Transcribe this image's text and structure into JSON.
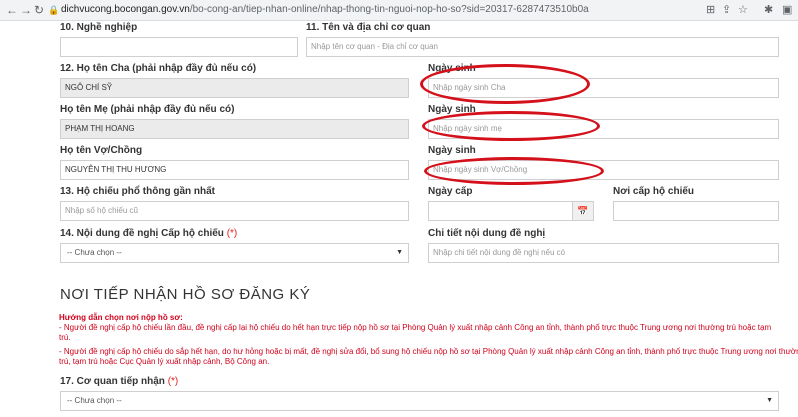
{
  "browser": {
    "url_host": "dichvucong.bocongan.gov.vn",
    "url_path": "/bo-cong-an/tiep-nhan-online/nhap-thong-tin-nguoi-nop-ho-so?sid=20317-6287473510b0a",
    "back_icon": "←",
    "forward_icon": "→",
    "reload_icon": "↻",
    "lock_icon": "🔒"
  },
  "fields": {
    "occupation": {
      "label": "10. Nghề nghiệp",
      "value": ""
    },
    "workplace": {
      "label": "11. Tên và địa chỉ cơ quan",
      "placeholder": "Nhập tên cơ quan - Địa chỉ cơ quan"
    },
    "father_name": {
      "label": "12. Họ tên Cha (phải nhập đầy đủ nếu có)",
      "value": "NGÔ CHÍ SỸ"
    },
    "father_dob": {
      "label": "Ngày sinh",
      "placeholder": "Nhập ngày sinh Cha"
    },
    "mother_name": {
      "label": "Họ tên Mẹ (phải nhập đầy đủ nếu có)",
      "value": "PHẠM THỊ HOANG"
    },
    "mother_dob": {
      "label": "Ngày sinh",
      "placeholder": "Nhập ngày sinh mẹ"
    },
    "spouse_name": {
      "label": "Họ tên Vợ/Chồng",
      "value": "NGUYỄN THỊ THU HƯƠNG"
    },
    "spouse_dob": {
      "label": "Ngày sinh",
      "placeholder": "Nhập ngày sinh Vợ/Chồng"
    },
    "passport_no": {
      "label": "13. Hộ chiếu phổ thông gần nhất",
      "placeholder": "Nhập số hộ chiếu cũ"
    },
    "issue_date": {
      "label": "Ngày cấp",
      "value": ""
    },
    "issue_place": {
      "label": "Nơi cấp hộ chiếu",
      "value": ""
    },
    "request": {
      "label": "14. Nội dung đề nghị Cấp hộ chiếu",
      "required": "(*)",
      "selected": "-- Chưa chọn --"
    },
    "request_detail": {
      "label": "Chi tiết nội dung đề nghị",
      "placeholder": "Nhập chi tiết nội dung đề nghị nếu có"
    },
    "receiving_agency": {
      "label": "17. Cơ quan tiếp nhận",
      "required": "(*)",
      "selected": "-- Chưa chọn --"
    }
  },
  "section": {
    "title": "NƠI TIẾP NHẬN HỒ SƠ ĐĂNG KÝ",
    "guide_heading": "Hướng dẫn chọn nơi nộp hồ sơ:",
    "guide_line1": "- Người đề nghị cấp hộ chiếu lần đầu, đề nghị cấp lại hộ chiếu do hết hạn trực tiếp nộp hồ sơ tại Phòng Quản lý xuất nhập cảnh Công an tỉnh, thành phố trực thuộc Trung ương nơi thường trú hoặc tạm",
    "guide_line1b": "trú.",
    "guide_line2": "- Người đề nghị cấp hộ chiếu do sắp hết hạn, do hư hỏng hoặc bị mất, đề nghị sửa đổi, bổ sung hộ chiếu nộp hồ sơ tại Phòng Quản lý xuất nhập cảnh Công an tỉnh, thành phố trực thuộc Trung ương nơi thường",
    "guide_line2b": "trú, tạm trú hoặc Cục Quản lý xuất nhập cảnh, Bộ Công an."
  },
  "icons": {
    "calendar": "📅",
    "caret": "▼"
  },
  "annotation_color": "#d4101a"
}
